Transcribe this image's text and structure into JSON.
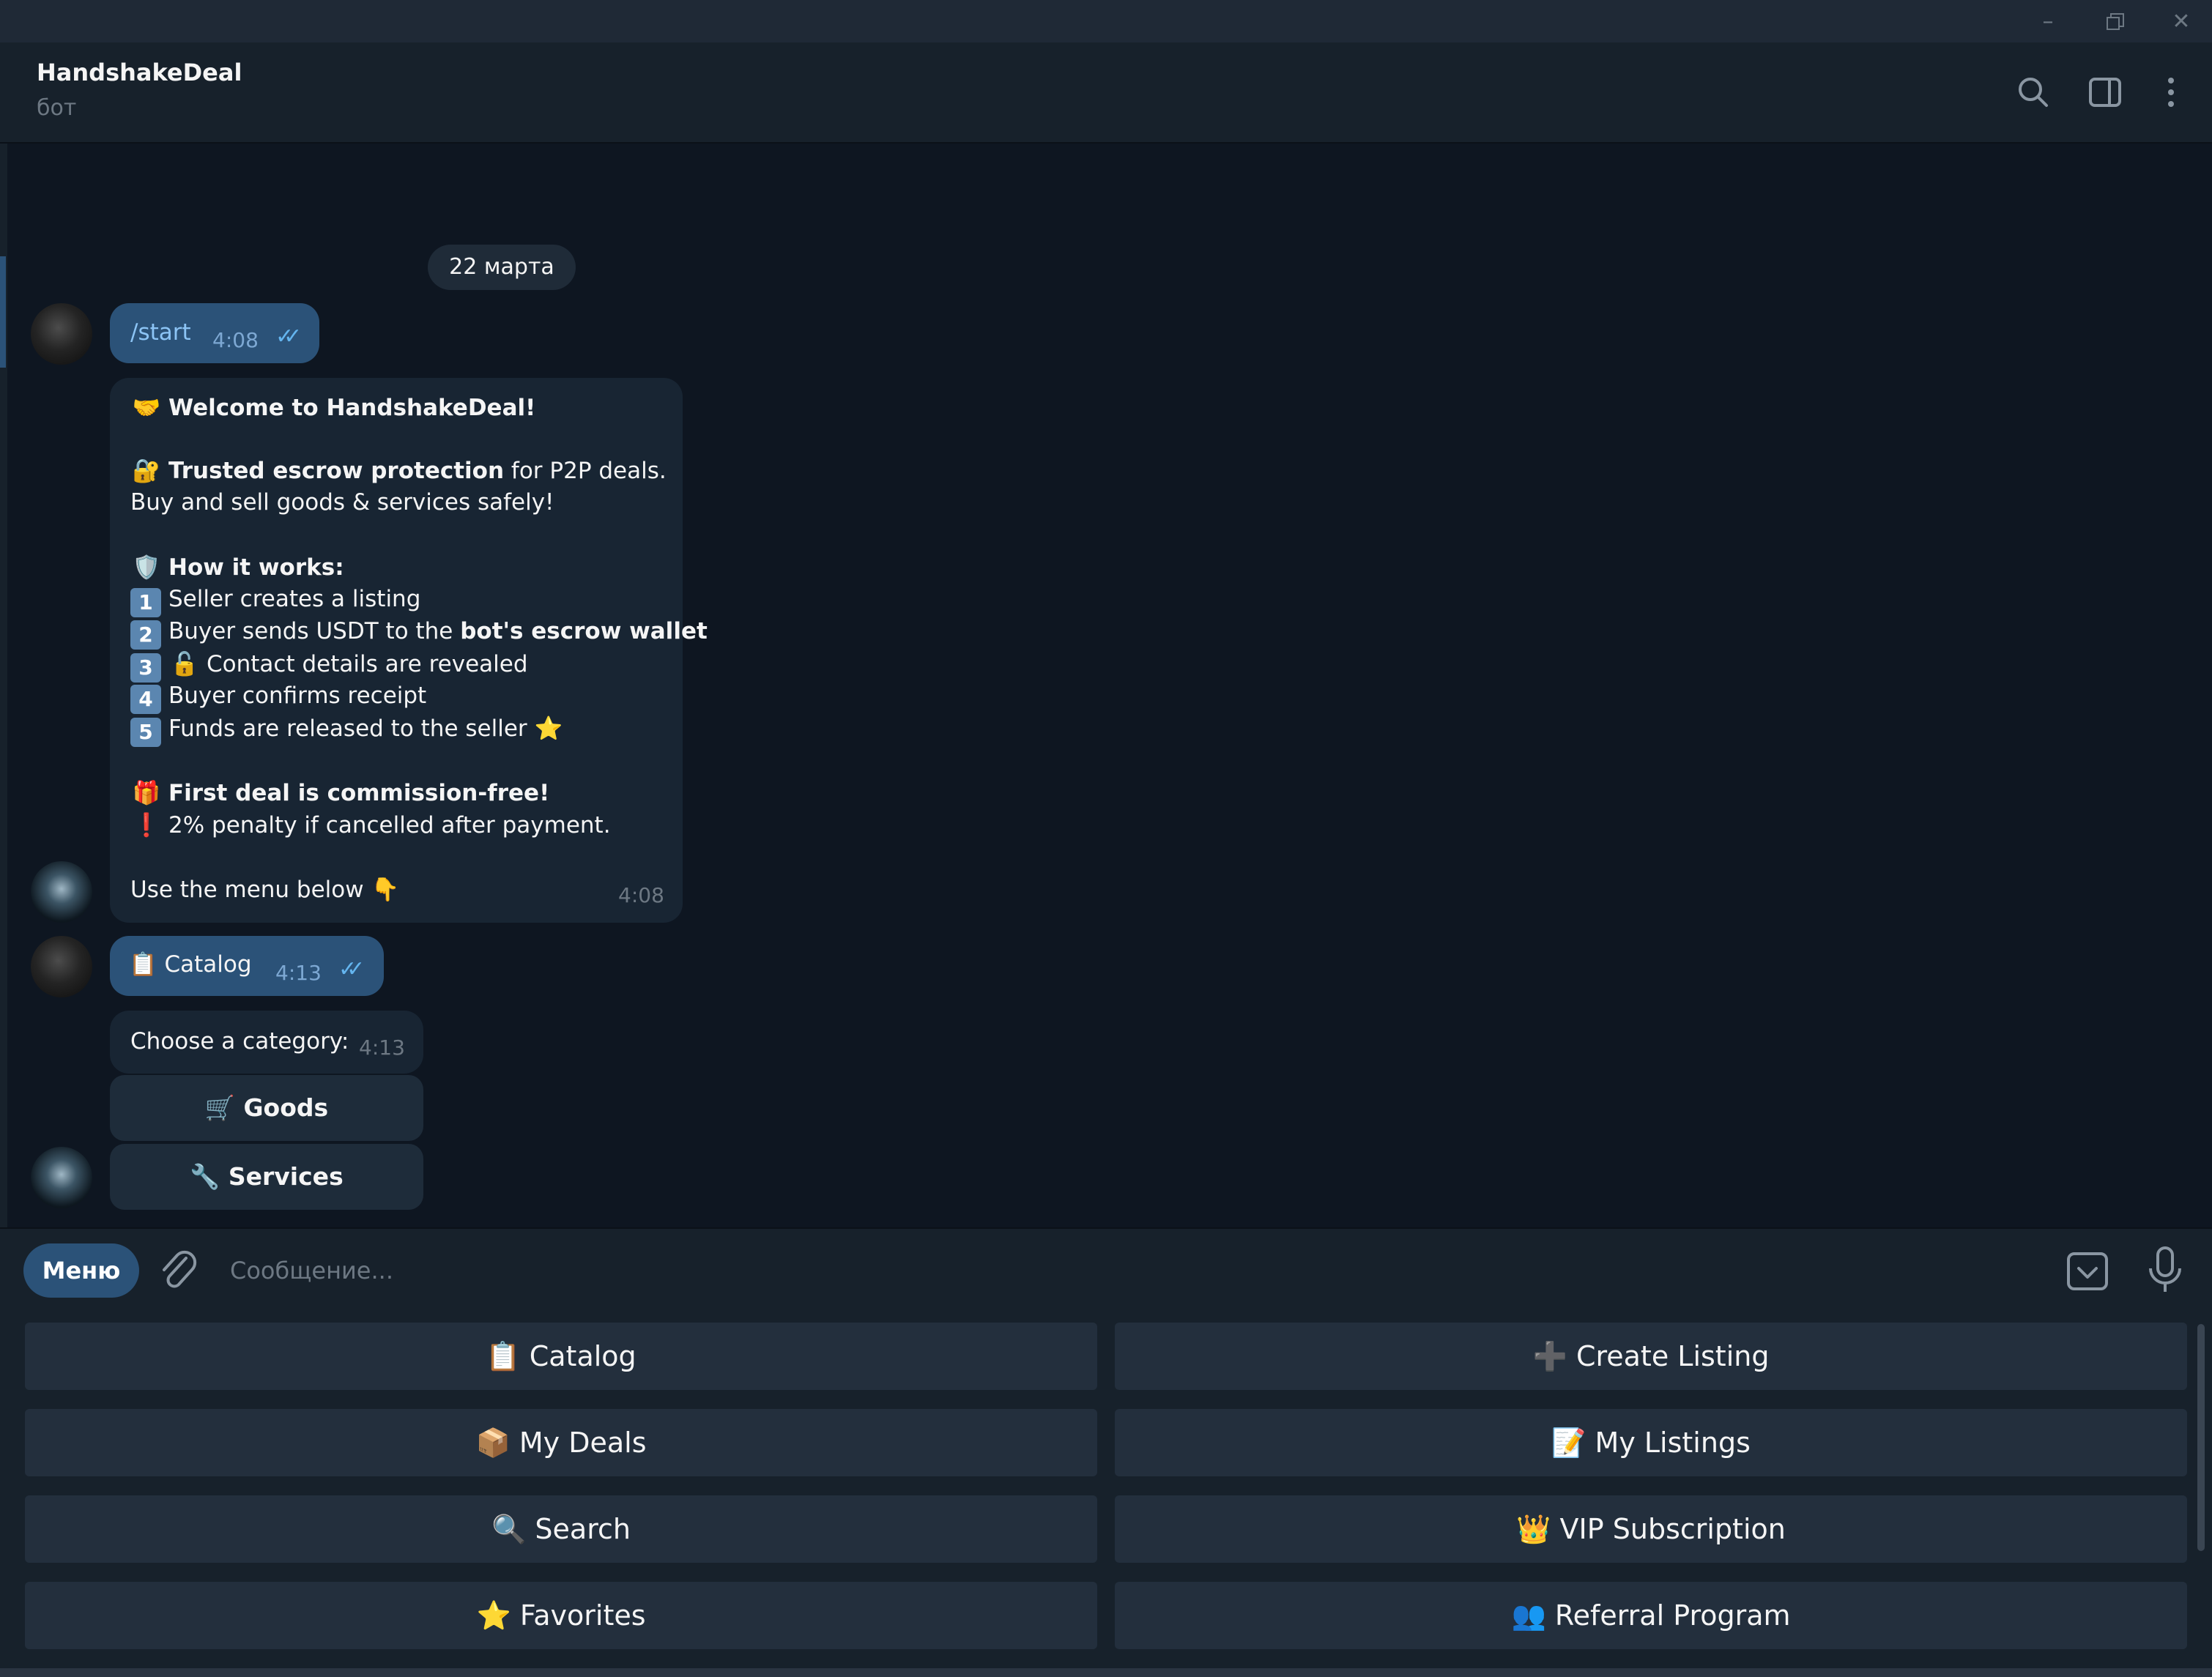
{
  "window": {
    "minimize_icon": "minimize-icon",
    "restore_icon": "restore-icon",
    "close_icon": "close-icon"
  },
  "header": {
    "title": "HandshakeDeal",
    "subtitle": "бот"
  },
  "chat": {
    "date_separator": "22 марта",
    "messages": [
      {
        "text": "/start",
        "time": "4:08"
      },
      {
        "time": "4:08",
        "lines": [
          {
            "emoji": "🤝",
            "bold": "Welcome to HandshakeDeal!"
          },
          {
            "emoji": "🔐",
            "bold": "Trusted escrow protection",
            "rest": " for P2P deals."
          },
          {
            "rest": "Buy and sell goods & services safely!"
          },
          {
            "emoji": "🛡️",
            "bold": "How it works:"
          },
          {
            "num": "1",
            "rest": "Seller creates a listing"
          },
          {
            "num": "2",
            "rest": "Buyer sends USDT to the ",
            "bold_end": "bot's escrow wallet"
          },
          {
            "num": "3",
            "emoji": "🔓",
            "rest": "Contact details are revealed"
          },
          {
            "num": "4",
            "rest": "Buyer confirms receipt"
          },
          {
            "num": "5",
            "rest": "Funds are released to the seller ",
            "emoji_end": "⭐"
          },
          {
            "emoji": "🎁",
            "bold": "First deal is commission-free!"
          },
          {
            "emoji": "❗",
            "rest": "2% penalty if cancelled after payment."
          },
          {
            "rest": "Use the menu below ",
            "emoji_end": "👇"
          }
        ]
      },
      {
        "emoji": "📋",
        "text": "Catalog",
        "time": "4:13"
      },
      {
        "text": "Choose a category:",
        "time": "4:13"
      }
    ],
    "inline_buttons": [
      {
        "emoji": "🛒",
        "label": "Goods"
      },
      {
        "emoji": "🔧",
        "label": "Services"
      }
    ]
  },
  "input": {
    "menu_label": "Меню",
    "placeholder": "Сообщение..."
  },
  "keyboard": [
    {
      "emoji": "📋",
      "label": "Catalog"
    },
    {
      "emoji": "➕",
      "label": "Create Listing"
    },
    {
      "emoji": "📦",
      "label": "My Deals"
    },
    {
      "emoji": "📝",
      "label": "My Listings"
    },
    {
      "emoji": "🔍",
      "label": "Search"
    },
    {
      "emoji": "👑",
      "label": "VIP Subscription"
    },
    {
      "emoji": "⭐",
      "label": "Favorites"
    },
    {
      "emoji": "👥",
      "label": "Referral Program"
    }
  ],
  "colors": {
    "outgoing_bubble": "#2b5278",
    "incoming_bubble": "#182533",
    "background": "#0e1621",
    "accent": "#64b5ef"
  }
}
